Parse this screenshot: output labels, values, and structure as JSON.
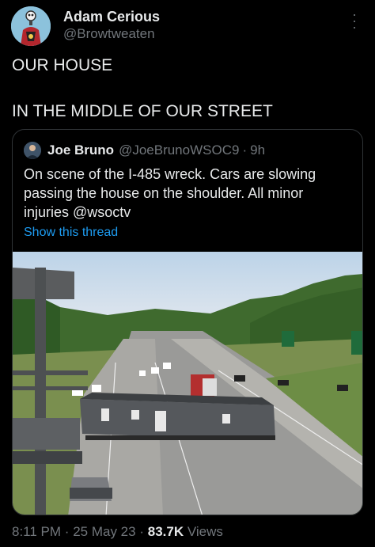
{
  "author": {
    "name": "Adam Cerious",
    "handle": "@Browtweaten"
  },
  "tweet": {
    "line1": "OUR HOUSE",
    "line2": "IN THE MIDDLE OF OUR STREET"
  },
  "quoted": {
    "name": "Joe Bruno",
    "handle": "@JoeBrunoWSOC9",
    "sep": "·",
    "time": "9h",
    "text": "On scene of the I-485 wreck. Cars are slowing passing the house on the shoulder. All minor injuries @wsoctv",
    "show_thread": "Show this thread"
  },
  "meta": {
    "time": "8:11 PM",
    "sep1": "·",
    "date": "25 May 23",
    "sep2": "·",
    "views_count": "83.7K",
    "views_label": "Views"
  },
  "colors": {
    "background": "#000000",
    "text": "#e7e9ea",
    "muted": "#71767b",
    "link": "#1d9bf0",
    "border": "#2f3336"
  }
}
